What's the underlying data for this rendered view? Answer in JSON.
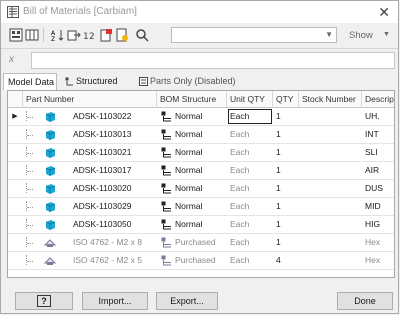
{
  "window": {
    "title": "Bill of Materials [Carbiam]",
    "close_glyph": "✕"
  },
  "toolbar": {
    "combo_value": "",
    "show_label": "Show"
  },
  "formula": {
    "fx_label": "x",
    "value": ""
  },
  "tabs": [
    {
      "label": "Model Data",
      "active": true
    },
    {
      "label": "Structured",
      "active": false
    },
    {
      "label": "Parts Only (Disabled)",
      "active": false
    }
  ],
  "columns": [
    "Part Number",
    "BOM Structure",
    "Unit QTY",
    "QTY",
    "Stock Number",
    "Descrip"
  ],
  "rows": [
    {
      "selected": true,
      "part": "ADSK-1103022",
      "icon": "part-cube-icon",
      "bom": "Normal",
      "unit": "Each",
      "qty": "1",
      "stock": "",
      "desc": "UH."
    },
    {
      "selected": false,
      "part": "ADSK-1103013",
      "icon": "part-cube-icon",
      "bom": "Normal",
      "unit": "Each",
      "qty": "1",
      "stock": "",
      "desc": "INT"
    },
    {
      "selected": false,
      "part": "ADSK-1103021",
      "icon": "part-cube-icon",
      "bom": "Normal",
      "unit": "Each",
      "qty": "1",
      "stock": "",
      "desc": "SLI"
    },
    {
      "selected": false,
      "part": "ADSK-1103017",
      "icon": "part-cube-icon",
      "bom": "Normal",
      "unit": "Each",
      "qty": "1",
      "stock": "",
      "desc": "AIR"
    },
    {
      "selected": false,
      "part": "ADSK-1103020",
      "icon": "part-cube-icon",
      "bom": "Normal",
      "unit": "Each",
      "qty": "1",
      "stock": "",
      "desc": "DUS"
    },
    {
      "selected": false,
      "part": "ADSK-1103029",
      "icon": "part-cube-icon",
      "bom": "Normal",
      "unit": "Each",
      "qty": "1",
      "stock": "",
      "desc": "MID"
    },
    {
      "selected": false,
      "part": "ADSK-1103050",
      "icon": "part-cube-icon",
      "bom": "Normal",
      "unit": "Each",
      "qty": "1",
      "stock": "",
      "desc": "HIG"
    },
    {
      "selected": false,
      "part": "ISO 4762 - M2 x 8",
      "icon": "content-center-part-icon",
      "bom": "Purchased",
      "unit": "Each",
      "qty": "1",
      "stock": "",
      "desc": "Hex"
    },
    {
      "selected": false,
      "part": "ISO 4762 - M2 x 5",
      "icon": "content-center-part-icon",
      "bom": "Purchased",
      "unit": "Each",
      "qty": "4",
      "stock": "",
      "desc": "Hex"
    }
  ],
  "buttons": {
    "help": "?",
    "import": "Import...",
    "export": "Export...",
    "done": "Done"
  },
  "colors": {
    "cube": "#1ba8d8",
    "purchased_icon": "#7a7a9a",
    "bom_icon": "#222222"
  }
}
